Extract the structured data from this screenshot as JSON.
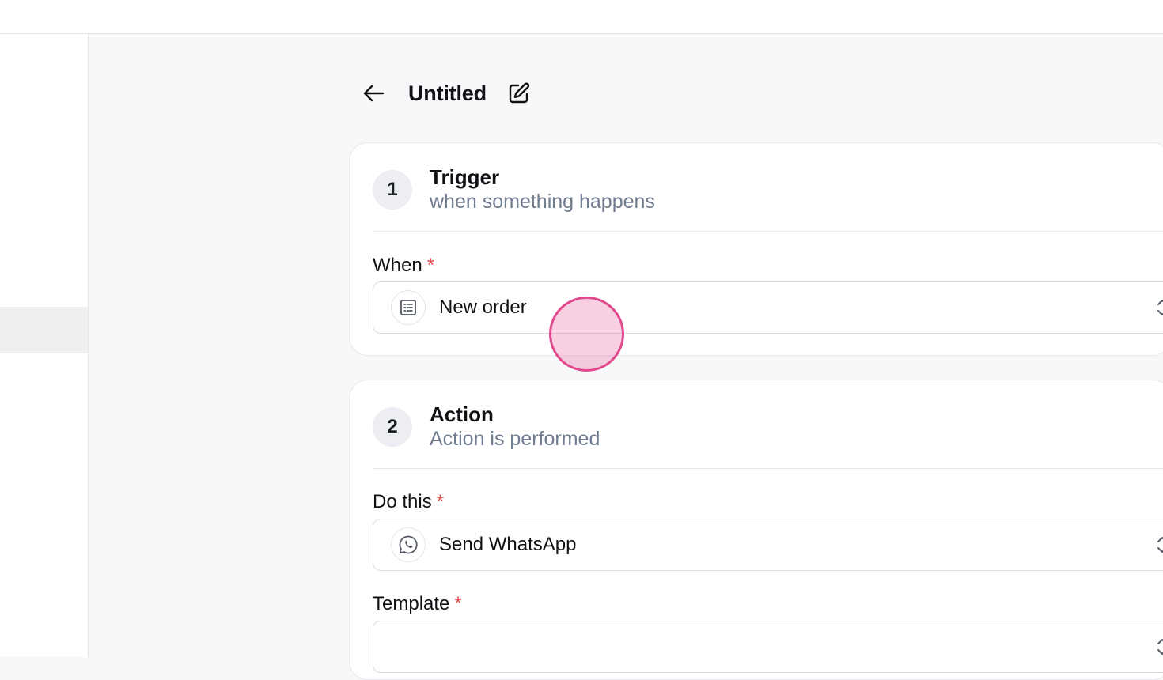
{
  "header": {
    "title": "Untitled"
  },
  "trigger": {
    "step_number": "1",
    "title": "Trigger",
    "subtitle": "when something happens",
    "field_label": "When",
    "required_mark": "*",
    "selected_value": "New order",
    "icon": "list-icon"
  },
  "action": {
    "step_number": "2",
    "title": "Action",
    "subtitle": "Action is performed",
    "do_label": "Do this",
    "required_mark": "*",
    "do_value": "Send WhatsApp",
    "do_icon": "whatsapp-icon",
    "template_label": "Template",
    "template_value": ""
  },
  "colors": {
    "required": "#e5484d",
    "subtitle": "#6f7b8e",
    "cursor_highlight": "#e0498c"
  }
}
